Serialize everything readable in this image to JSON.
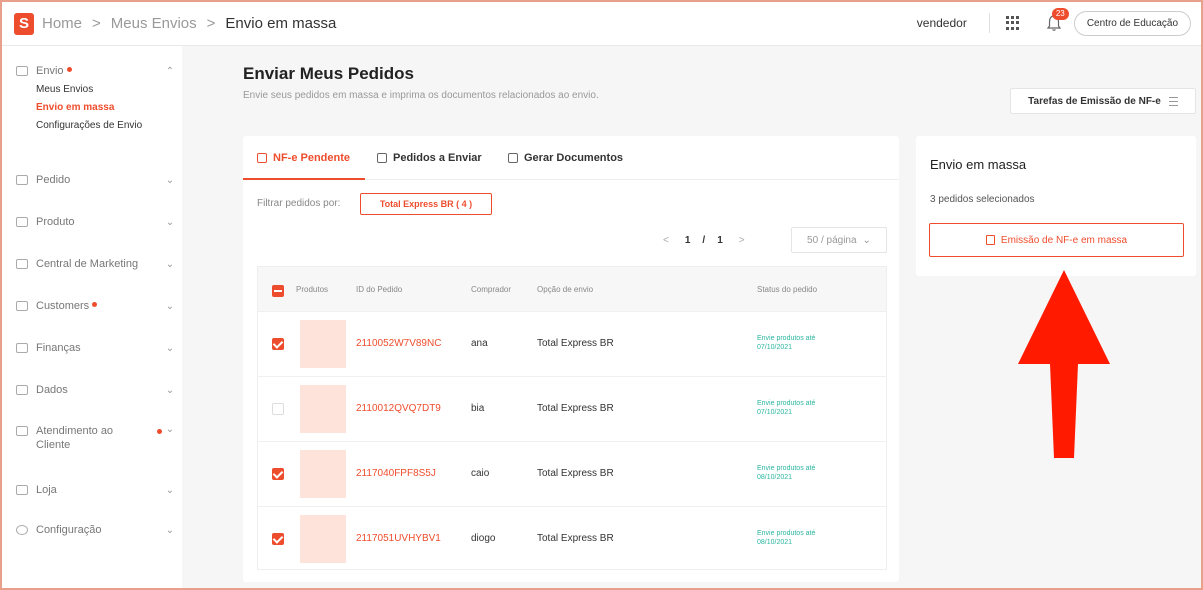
{
  "colors": {
    "accent": "#ee4d2d",
    "status": "#2bb5a0",
    "thumb": "#fde3da",
    "arrow": "#ff1a00"
  },
  "topbar": {
    "logo": "S",
    "breadcrumb": [
      "Home",
      "Meus Envios",
      "Envio em massa"
    ],
    "separator": ">",
    "seller": "vendedor",
    "notification_count": "23",
    "education_button": "Centro de Educação"
  },
  "sidebar": {
    "envio": {
      "label": "Envio",
      "items": [
        "Meus Envios",
        "Envio em massa",
        "Configurações de Envio"
      ]
    },
    "groups": [
      {
        "label": "Pedido"
      },
      {
        "label": "Produto"
      },
      {
        "label": "Central de Marketing"
      },
      {
        "label": "Customers"
      },
      {
        "label": "Finanças"
      },
      {
        "label": "Dados"
      },
      {
        "label": "Atendimento ao Cliente"
      },
      {
        "label": "Loja"
      },
      {
        "label": "Configuração"
      }
    ]
  },
  "main": {
    "title": "Enviar Meus Pedidos",
    "subtitle": "Envie seus pedidos em massa e imprima os documentos relacionados ao envio.",
    "tarefas_button": "Tarefas de Emissão de NF-e",
    "tabs": [
      "NF-e Pendente",
      "Pedidos a Enviar",
      "Gerar Documentos"
    ],
    "filter_label": "Filtrar pedidos por:",
    "filter_chip": "Total Express BR  ( 4 )",
    "pager": {
      "prev": "<",
      "current": "1",
      "slash": "/",
      "total": "1",
      "next": ">"
    },
    "per_page": "50 / página",
    "table": {
      "headers": [
        "Produtos",
        "ID do Pedido",
        "Comprador",
        "Opção de envio",
        "Status do pedido"
      ],
      "rows": [
        {
          "id": "2110052W7V89NC",
          "buyer": "ana",
          "ship": "Total Express BR",
          "status": "Envie produtos até 07/10/2021",
          "checked": true
        },
        {
          "id": "2110012QVQ7DT9",
          "buyer": "bia",
          "ship": "Total Express BR",
          "status": "Envie produtos até 07/10/2021",
          "checked": false
        },
        {
          "id": "2117040FPF8S5J",
          "buyer": "caio",
          "ship": "Total Express BR",
          "status": "Envie produtos até 08/10/2021",
          "checked": true
        },
        {
          "id": "2117051UVHYBV1",
          "buyer": "diogo",
          "ship": "Total Express BR",
          "status": "Envie produtos até 08/10/2021",
          "checked": true
        }
      ]
    }
  },
  "right_panel": {
    "title": "Envio em massa",
    "selected": "3 pedidos selecionados",
    "button": "Emissão de NF-e em massa"
  }
}
